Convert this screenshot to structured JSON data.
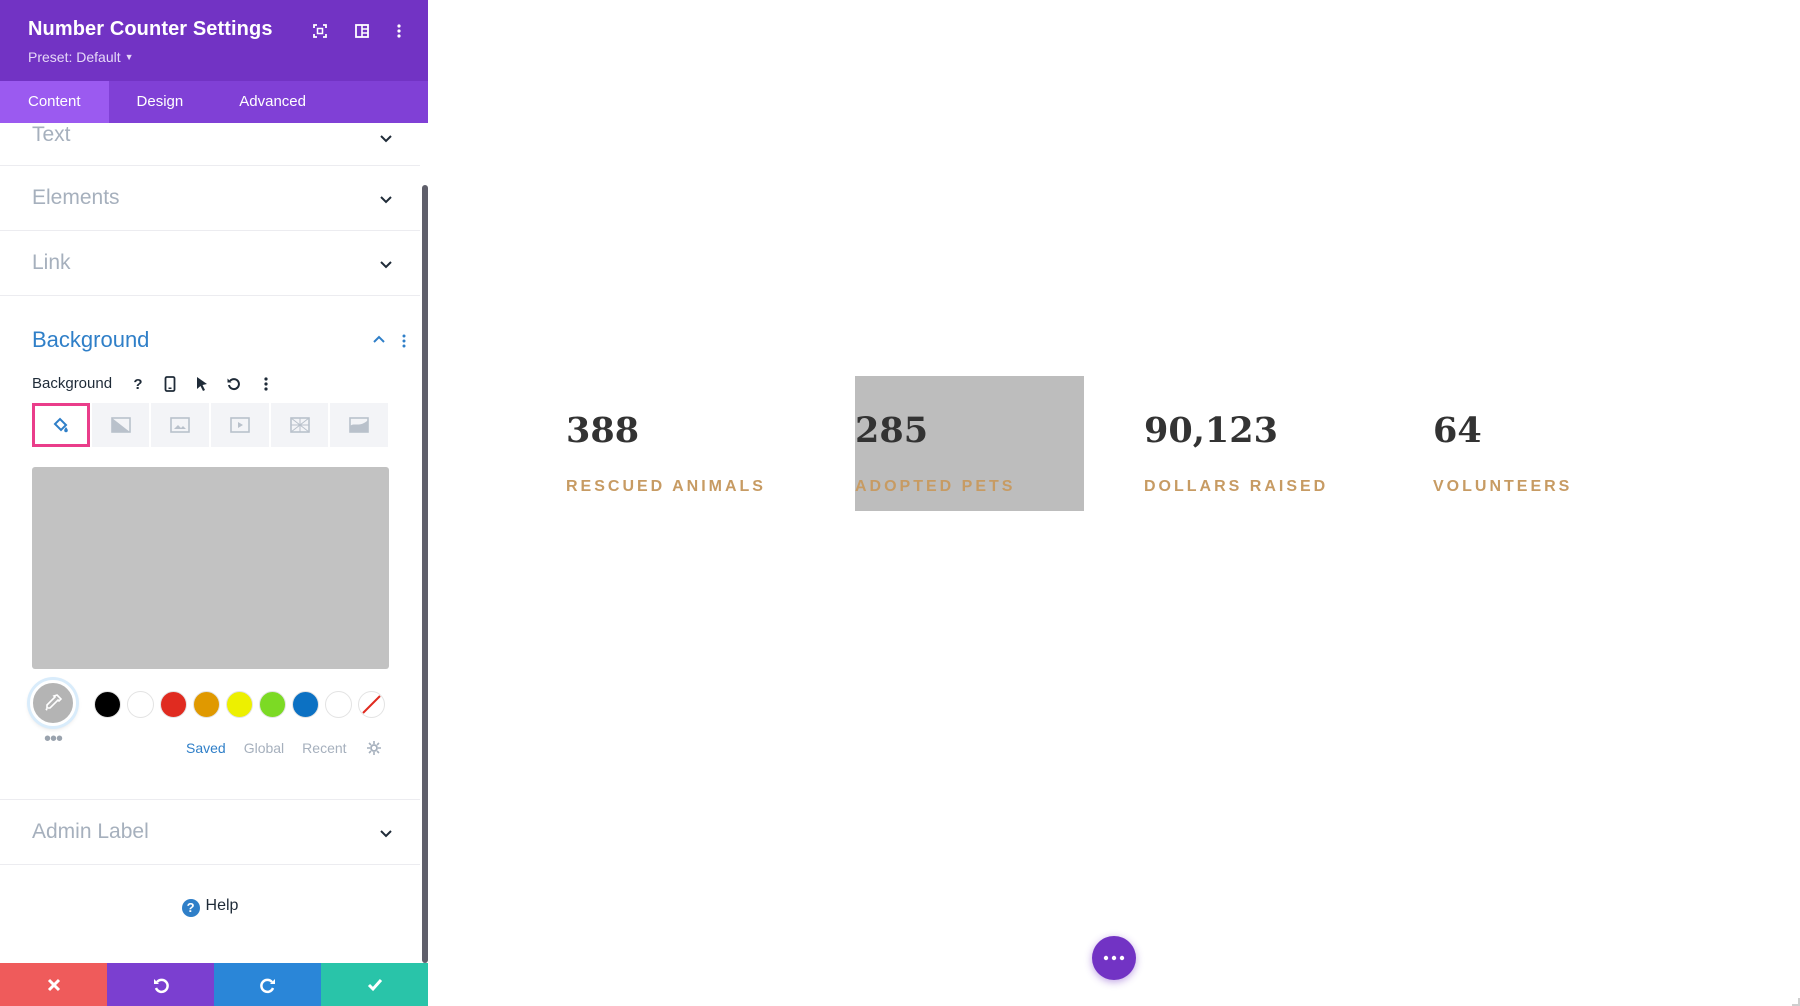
{
  "panel": {
    "title": "Number Counter Settings",
    "preset": "Preset: Default",
    "tabs": [
      {
        "label": "Content",
        "active": true
      },
      {
        "label": "Design",
        "active": false
      },
      {
        "label": "Advanced",
        "active": false
      }
    ]
  },
  "sections": {
    "text": "Text",
    "elements": "Elements",
    "link": "Link",
    "background": "Background",
    "admin_label": "Admin Label"
  },
  "background": {
    "field_label": "Background",
    "types": [
      "color",
      "gradient",
      "image",
      "video",
      "pattern",
      "mask"
    ],
    "active_type": "color",
    "preview_color": "#c2c2c2",
    "swatches": [
      "#000000",
      "#ffffff",
      "#e02b20",
      "#e09900",
      "#edf000",
      "#7cda24",
      "#0c71c3",
      "#ffffff"
    ],
    "palette_tabs": [
      {
        "label": "Saved",
        "active": true
      },
      {
        "label": "Global",
        "active": false
      },
      {
        "label": "Recent",
        "active": false
      }
    ]
  },
  "help": "Help",
  "footer": {
    "colors": {
      "cancel": "#ef5b5b",
      "undo": "#7b3fd0",
      "redo": "#2a86d8",
      "save": "#29c4a9"
    }
  },
  "counters": [
    {
      "number": "388",
      "label": "RESCUED ANIMALS",
      "highlighted": false
    },
    {
      "number": "285",
      "label": "ADOPTED PETS",
      "highlighted": true
    },
    {
      "number": "90,123",
      "label": "DOLLARS RAISED",
      "highlighted": false
    },
    {
      "number": "64",
      "label": "VOLUNTEERS",
      "highlighted": false
    }
  ],
  "accent": {
    "purple": "#7233c4",
    "blue": "#2f7fc8",
    "pink": "#ea3d8a",
    "gold": "#c79b63"
  }
}
